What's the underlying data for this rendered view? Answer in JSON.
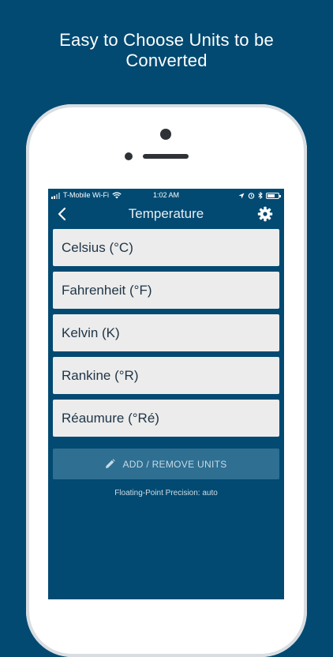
{
  "headline": {
    "line1": "Easy to Choose Units to be",
    "line2": "Converted"
  },
  "status_bar": {
    "carrier": "T-Mobile Wi-Fi",
    "time": "1:02 AM"
  },
  "nav": {
    "title": "Temperature",
    "back_icon": "chevron-left-icon",
    "settings_icon": "gear-icon"
  },
  "units": [
    {
      "label": "Celsius (°C)"
    },
    {
      "label": "Fahrenheit (°F)"
    },
    {
      "label": "Kelvin (K)"
    },
    {
      "label": "Rankine (°R)"
    },
    {
      "label": "Réaumure (°Ré)"
    }
  ],
  "actions": {
    "add_remove_label": "ADD / REMOVE UNITS",
    "add_remove_icon": "pencil-icon"
  },
  "footer": {
    "precision_text": "Floating-Point Precision: auto"
  },
  "colors": {
    "background": "#024a72",
    "row_background": "#ececec",
    "button_background": "#2f6f92"
  }
}
